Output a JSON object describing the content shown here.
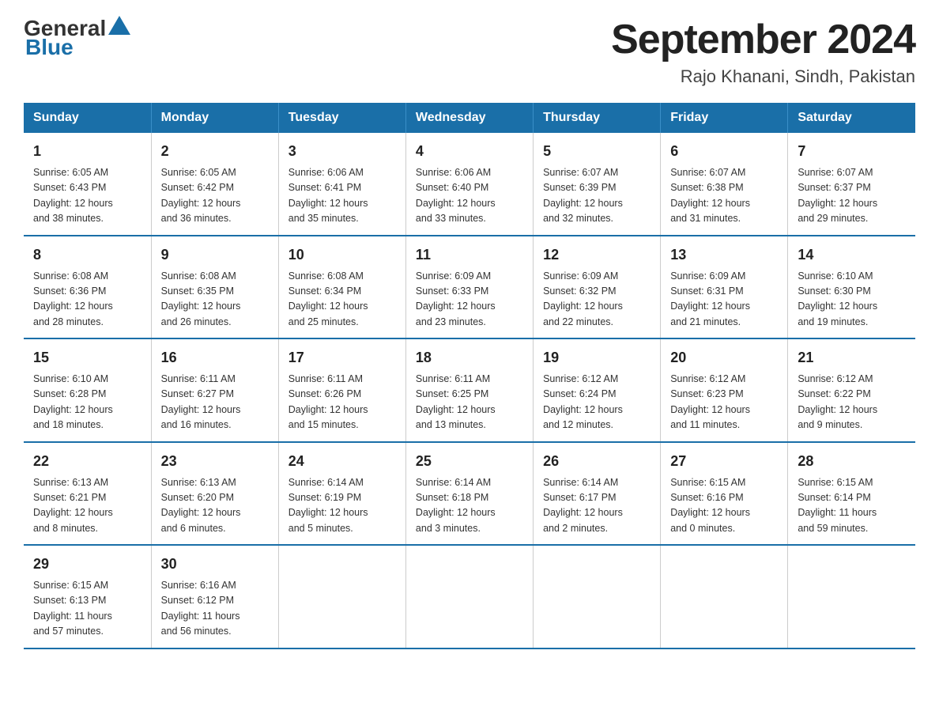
{
  "header": {
    "logo_general": "General",
    "logo_blue": "Blue",
    "month_year": "September 2024",
    "location": "Rajo Khanani, Sindh, Pakistan"
  },
  "weekdays": [
    "Sunday",
    "Monday",
    "Tuesday",
    "Wednesday",
    "Thursday",
    "Friday",
    "Saturday"
  ],
  "weeks": [
    [
      {
        "day": "1",
        "sunrise": "6:05 AM",
        "sunset": "6:43 PM",
        "daylight": "12 hours and 38 minutes."
      },
      {
        "day": "2",
        "sunrise": "6:05 AM",
        "sunset": "6:42 PM",
        "daylight": "12 hours and 36 minutes."
      },
      {
        "day": "3",
        "sunrise": "6:06 AM",
        "sunset": "6:41 PM",
        "daylight": "12 hours and 35 minutes."
      },
      {
        "day": "4",
        "sunrise": "6:06 AM",
        "sunset": "6:40 PM",
        "daylight": "12 hours and 33 minutes."
      },
      {
        "day": "5",
        "sunrise": "6:07 AM",
        "sunset": "6:39 PM",
        "daylight": "12 hours and 32 minutes."
      },
      {
        "day": "6",
        "sunrise": "6:07 AM",
        "sunset": "6:38 PM",
        "daylight": "12 hours and 31 minutes."
      },
      {
        "day": "7",
        "sunrise": "6:07 AM",
        "sunset": "6:37 PM",
        "daylight": "12 hours and 29 minutes."
      }
    ],
    [
      {
        "day": "8",
        "sunrise": "6:08 AM",
        "sunset": "6:36 PM",
        "daylight": "12 hours and 28 minutes."
      },
      {
        "day": "9",
        "sunrise": "6:08 AM",
        "sunset": "6:35 PM",
        "daylight": "12 hours and 26 minutes."
      },
      {
        "day": "10",
        "sunrise": "6:08 AM",
        "sunset": "6:34 PM",
        "daylight": "12 hours and 25 minutes."
      },
      {
        "day": "11",
        "sunrise": "6:09 AM",
        "sunset": "6:33 PM",
        "daylight": "12 hours and 23 minutes."
      },
      {
        "day": "12",
        "sunrise": "6:09 AM",
        "sunset": "6:32 PM",
        "daylight": "12 hours and 22 minutes."
      },
      {
        "day": "13",
        "sunrise": "6:09 AM",
        "sunset": "6:31 PM",
        "daylight": "12 hours and 21 minutes."
      },
      {
        "day": "14",
        "sunrise": "6:10 AM",
        "sunset": "6:30 PM",
        "daylight": "12 hours and 19 minutes."
      }
    ],
    [
      {
        "day": "15",
        "sunrise": "6:10 AM",
        "sunset": "6:28 PM",
        "daylight": "12 hours and 18 minutes."
      },
      {
        "day": "16",
        "sunrise": "6:11 AM",
        "sunset": "6:27 PM",
        "daylight": "12 hours and 16 minutes."
      },
      {
        "day": "17",
        "sunrise": "6:11 AM",
        "sunset": "6:26 PM",
        "daylight": "12 hours and 15 minutes."
      },
      {
        "day": "18",
        "sunrise": "6:11 AM",
        "sunset": "6:25 PM",
        "daylight": "12 hours and 13 minutes."
      },
      {
        "day": "19",
        "sunrise": "6:12 AM",
        "sunset": "6:24 PM",
        "daylight": "12 hours and 12 minutes."
      },
      {
        "day": "20",
        "sunrise": "6:12 AM",
        "sunset": "6:23 PM",
        "daylight": "12 hours and 11 minutes."
      },
      {
        "day": "21",
        "sunrise": "6:12 AM",
        "sunset": "6:22 PM",
        "daylight": "12 hours and 9 minutes."
      }
    ],
    [
      {
        "day": "22",
        "sunrise": "6:13 AM",
        "sunset": "6:21 PM",
        "daylight": "12 hours and 8 minutes."
      },
      {
        "day": "23",
        "sunrise": "6:13 AM",
        "sunset": "6:20 PM",
        "daylight": "12 hours and 6 minutes."
      },
      {
        "day": "24",
        "sunrise": "6:14 AM",
        "sunset": "6:19 PM",
        "daylight": "12 hours and 5 minutes."
      },
      {
        "day": "25",
        "sunrise": "6:14 AM",
        "sunset": "6:18 PM",
        "daylight": "12 hours and 3 minutes."
      },
      {
        "day": "26",
        "sunrise": "6:14 AM",
        "sunset": "6:17 PM",
        "daylight": "12 hours and 2 minutes."
      },
      {
        "day": "27",
        "sunrise": "6:15 AM",
        "sunset": "6:16 PM",
        "daylight": "12 hours and 0 minutes."
      },
      {
        "day": "28",
        "sunrise": "6:15 AM",
        "sunset": "6:14 PM",
        "daylight": "11 hours and 59 minutes."
      }
    ],
    [
      {
        "day": "29",
        "sunrise": "6:15 AM",
        "sunset": "6:13 PM",
        "daylight": "11 hours and 57 minutes."
      },
      {
        "day": "30",
        "sunrise": "6:16 AM",
        "sunset": "6:12 PM",
        "daylight": "11 hours and 56 minutes."
      },
      null,
      null,
      null,
      null,
      null
    ]
  ]
}
